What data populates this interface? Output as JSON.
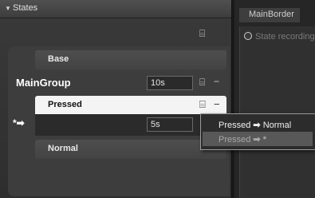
{
  "panel": {
    "title": "States",
    "add_state_group_icon": "add-state-group-icon"
  },
  "base": {
    "label": "Base"
  },
  "group": {
    "name": "MainGroup",
    "default_duration": "10s"
  },
  "states": [
    {
      "label": "Pressed",
      "transition_duration": "5s"
    },
    {
      "label": "Normal"
    }
  ],
  "transition_icons": {
    "any_to_pressed": "*➡"
  },
  "context_menu": {
    "items": [
      {
        "from": "Pressed",
        "arrow": "➡",
        "to": "Normal"
      },
      {
        "from": "Pressed",
        "arrow": "➡",
        "to": "*"
      }
    ]
  },
  "right_panel": {
    "tab": "MainBorder",
    "recorder_text": "State recording"
  }
}
